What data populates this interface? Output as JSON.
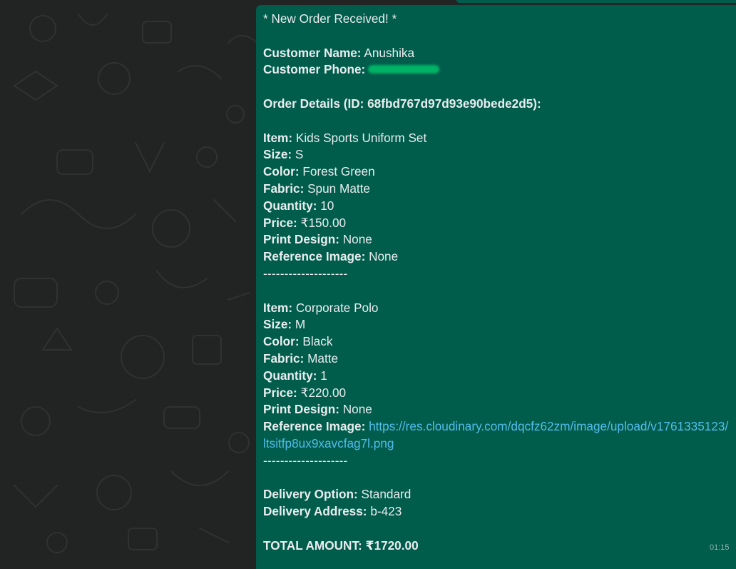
{
  "message": {
    "header": "* New Order Received! *",
    "customer": {
      "name_label": "Customer Name:",
      "name": "Anushika",
      "phone_label": "Customer Phone:"
    },
    "order": {
      "label": "Order Details (ID: 68fbd767d97d93e90bede2d5):"
    },
    "labels": {
      "item": "Item:",
      "size": "Size:",
      "color": "Color:",
      "fabric": "Fabric:",
      "quantity": "Quantity:",
      "price": "Price:",
      "print_design": "Print Design:",
      "reference_image": "Reference Image:"
    },
    "items": [
      {
        "item": "Kids Sports Uniform Set",
        "size": "S",
        "color": "Forest Green",
        "fabric": "Spun Matte",
        "quantity": "10",
        "price": "₹150.00",
        "print_design": "None",
        "reference_image": "None"
      },
      {
        "item": "Corporate Polo",
        "size": "M",
        "color": "Black",
        "fabric": "Matte",
        "quantity": "1",
        "price": "₹220.00",
        "print_design": "None",
        "reference_image_line1": "https://res.cloudinary.com/dqcfz62zm/image/upload/v1761335123/",
        "reference_image_line2": "ltsitfp8ux9xavcfag7l.png"
      }
    ],
    "separator": "--------------------",
    "delivery": {
      "option_label": "Delivery Option:",
      "option": "Standard",
      "address_label": "Delivery Address:",
      "address": "b-423"
    },
    "total": {
      "label": "TOTAL AMOUNT:",
      "value": "₹1720.00"
    },
    "time": "01:15"
  },
  "colors": {
    "chat_background": "#222423",
    "bubble": "#005c4b",
    "text": "#e9edef",
    "link": "#53bdeb",
    "redaction": "#00c26a"
  }
}
